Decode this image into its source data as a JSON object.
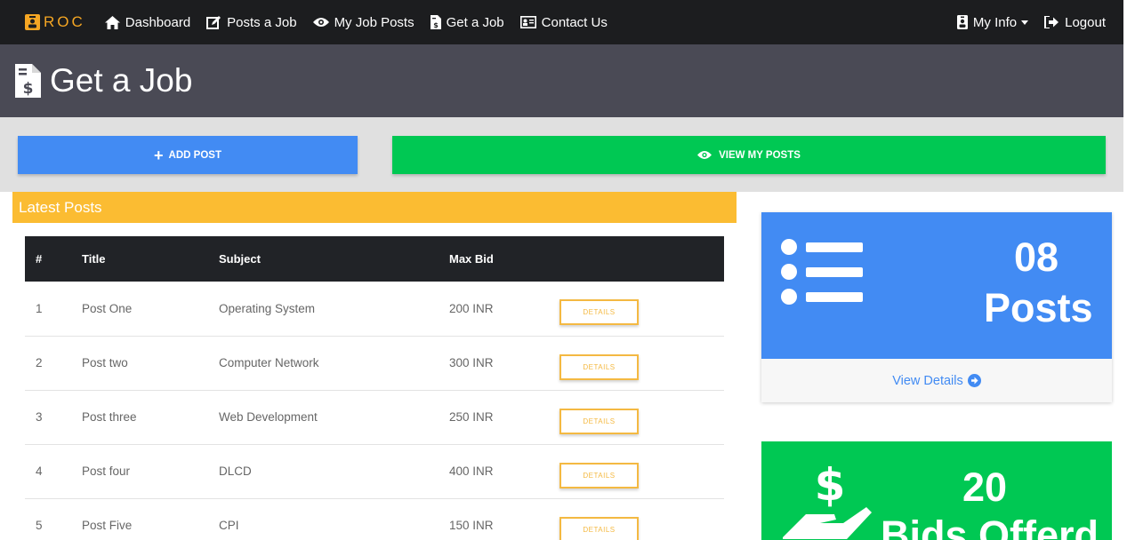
{
  "navbar": {
    "brand": "ROC",
    "items": [
      {
        "label": "Dashboard",
        "icon": "home-icon"
      },
      {
        "label": "Posts a Job",
        "icon": "edit-icon"
      },
      {
        "label": "My Job Posts",
        "icon": "eye-icon"
      },
      {
        "label": "Get a Job",
        "icon": "file-invoice-dollar-icon"
      },
      {
        "label": "Contact Us",
        "icon": "address-card-icon"
      }
    ],
    "my_info": "My Info",
    "logout": "Logout"
  },
  "header": {
    "title": "Get a Job",
    "icon": "file-invoice-dollar-icon"
  },
  "actions": {
    "add_post": "ADD POST",
    "view_my_posts": "VIEW MY POSTS"
  },
  "latest_posts": {
    "title": "Latest Posts",
    "columns": [
      "#",
      "Title",
      "Subject",
      "Max Bid"
    ],
    "details_label": "DETAILS",
    "rows": [
      {
        "num": "1",
        "title": "Post One",
        "subject": "Operating System",
        "max_bid": "200 INR"
      },
      {
        "num": "2",
        "title": "Post two",
        "subject": "Computer Network",
        "max_bid": "300 INR"
      },
      {
        "num": "3",
        "title": "Post three",
        "subject": "Web Development",
        "max_bid": "250 INR"
      },
      {
        "num": "4",
        "title": "Post four",
        "subject": "DLCD",
        "max_bid": "400 INR"
      },
      {
        "num": "5",
        "title": "Post Five",
        "subject": "CPI",
        "max_bid": "150 INR"
      }
    ]
  },
  "stats": {
    "posts": {
      "count": "08",
      "label": "Posts",
      "link": "View Details",
      "color": "#428bf3",
      "icon": "list-icon"
    },
    "bids": {
      "count": "20",
      "label": "Bids Offerd",
      "color": "#00c853",
      "icon": "hand-holding-usd-icon"
    }
  },
  "colors": {
    "navbar": "#1c1d1f",
    "header": "#4a4a55",
    "accent": "#fbbc32",
    "primary": "#428bf3",
    "success": "#00c853"
  }
}
